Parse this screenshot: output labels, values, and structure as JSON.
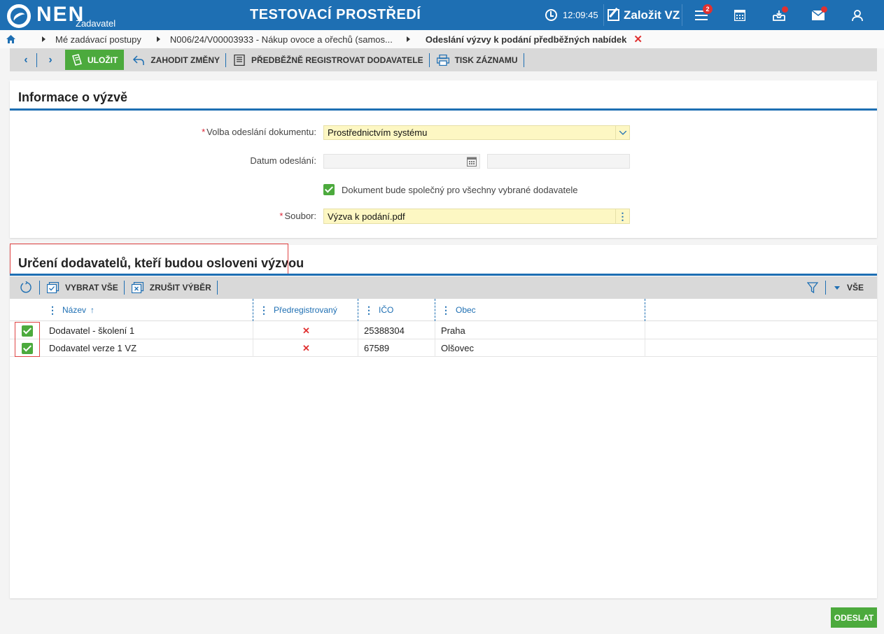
{
  "app": {
    "logo_text": "NEN",
    "role": "Zadavatel",
    "env_title": "TESTOVACÍ PROSTŘEDÍ",
    "clock": "12:09:45",
    "create_label": "Založit VZ",
    "menu_badge": "2"
  },
  "breadcrumb": {
    "items": [
      "Mé zadávací postupy",
      "N006/24/V00003933 - Nákup ovoce a ořechů (samos...",
      "Odeslání výzvy k podání předběžných nabídek"
    ]
  },
  "toolbar": {
    "save": "ULOŽIT",
    "discard": "ZAHODIT ZMĚNY",
    "preregister": "PŘEDBĚŽNĚ REGISTROVAT DODAVATELE",
    "print": "TISK ZÁZNAMU"
  },
  "info": {
    "title": "Informace o výzvě",
    "send_option_label": "Volba odeslání dokumentu:",
    "send_option_value": "Prostřednictvím systému",
    "date_label": "Datum odeslání:",
    "shared_doc_label": "Dokument bude společný pro všechny vybrané dodavatele",
    "file_label": "Soubor:",
    "file_value": "Výzva k podání.pdf"
  },
  "suppliers": {
    "title": "Určení dodavatelů, kteří budou osloveni výzvou",
    "select_all": "VYBRAT VŠE",
    "clear_selection": "ZRUŠIT VÝBĚR",
    "filter_all": "VŠE",
    "columns": [
      "Název",
      "Předregistrovaný",
      "IČO",
      "Obec"
    ],
    "rows": [
      {
        "name": "Dodavatel - školení 1",
        "ico": "25388304",
        "city": "Praha"
      },
      {
        "name": "Dodavatel verze 1 VZ",
        "ico": "67589",
        "city": "Olšovec"
      }
    ]
  },
  "footer": {
    "send": "ODESLAT"
  }
}
